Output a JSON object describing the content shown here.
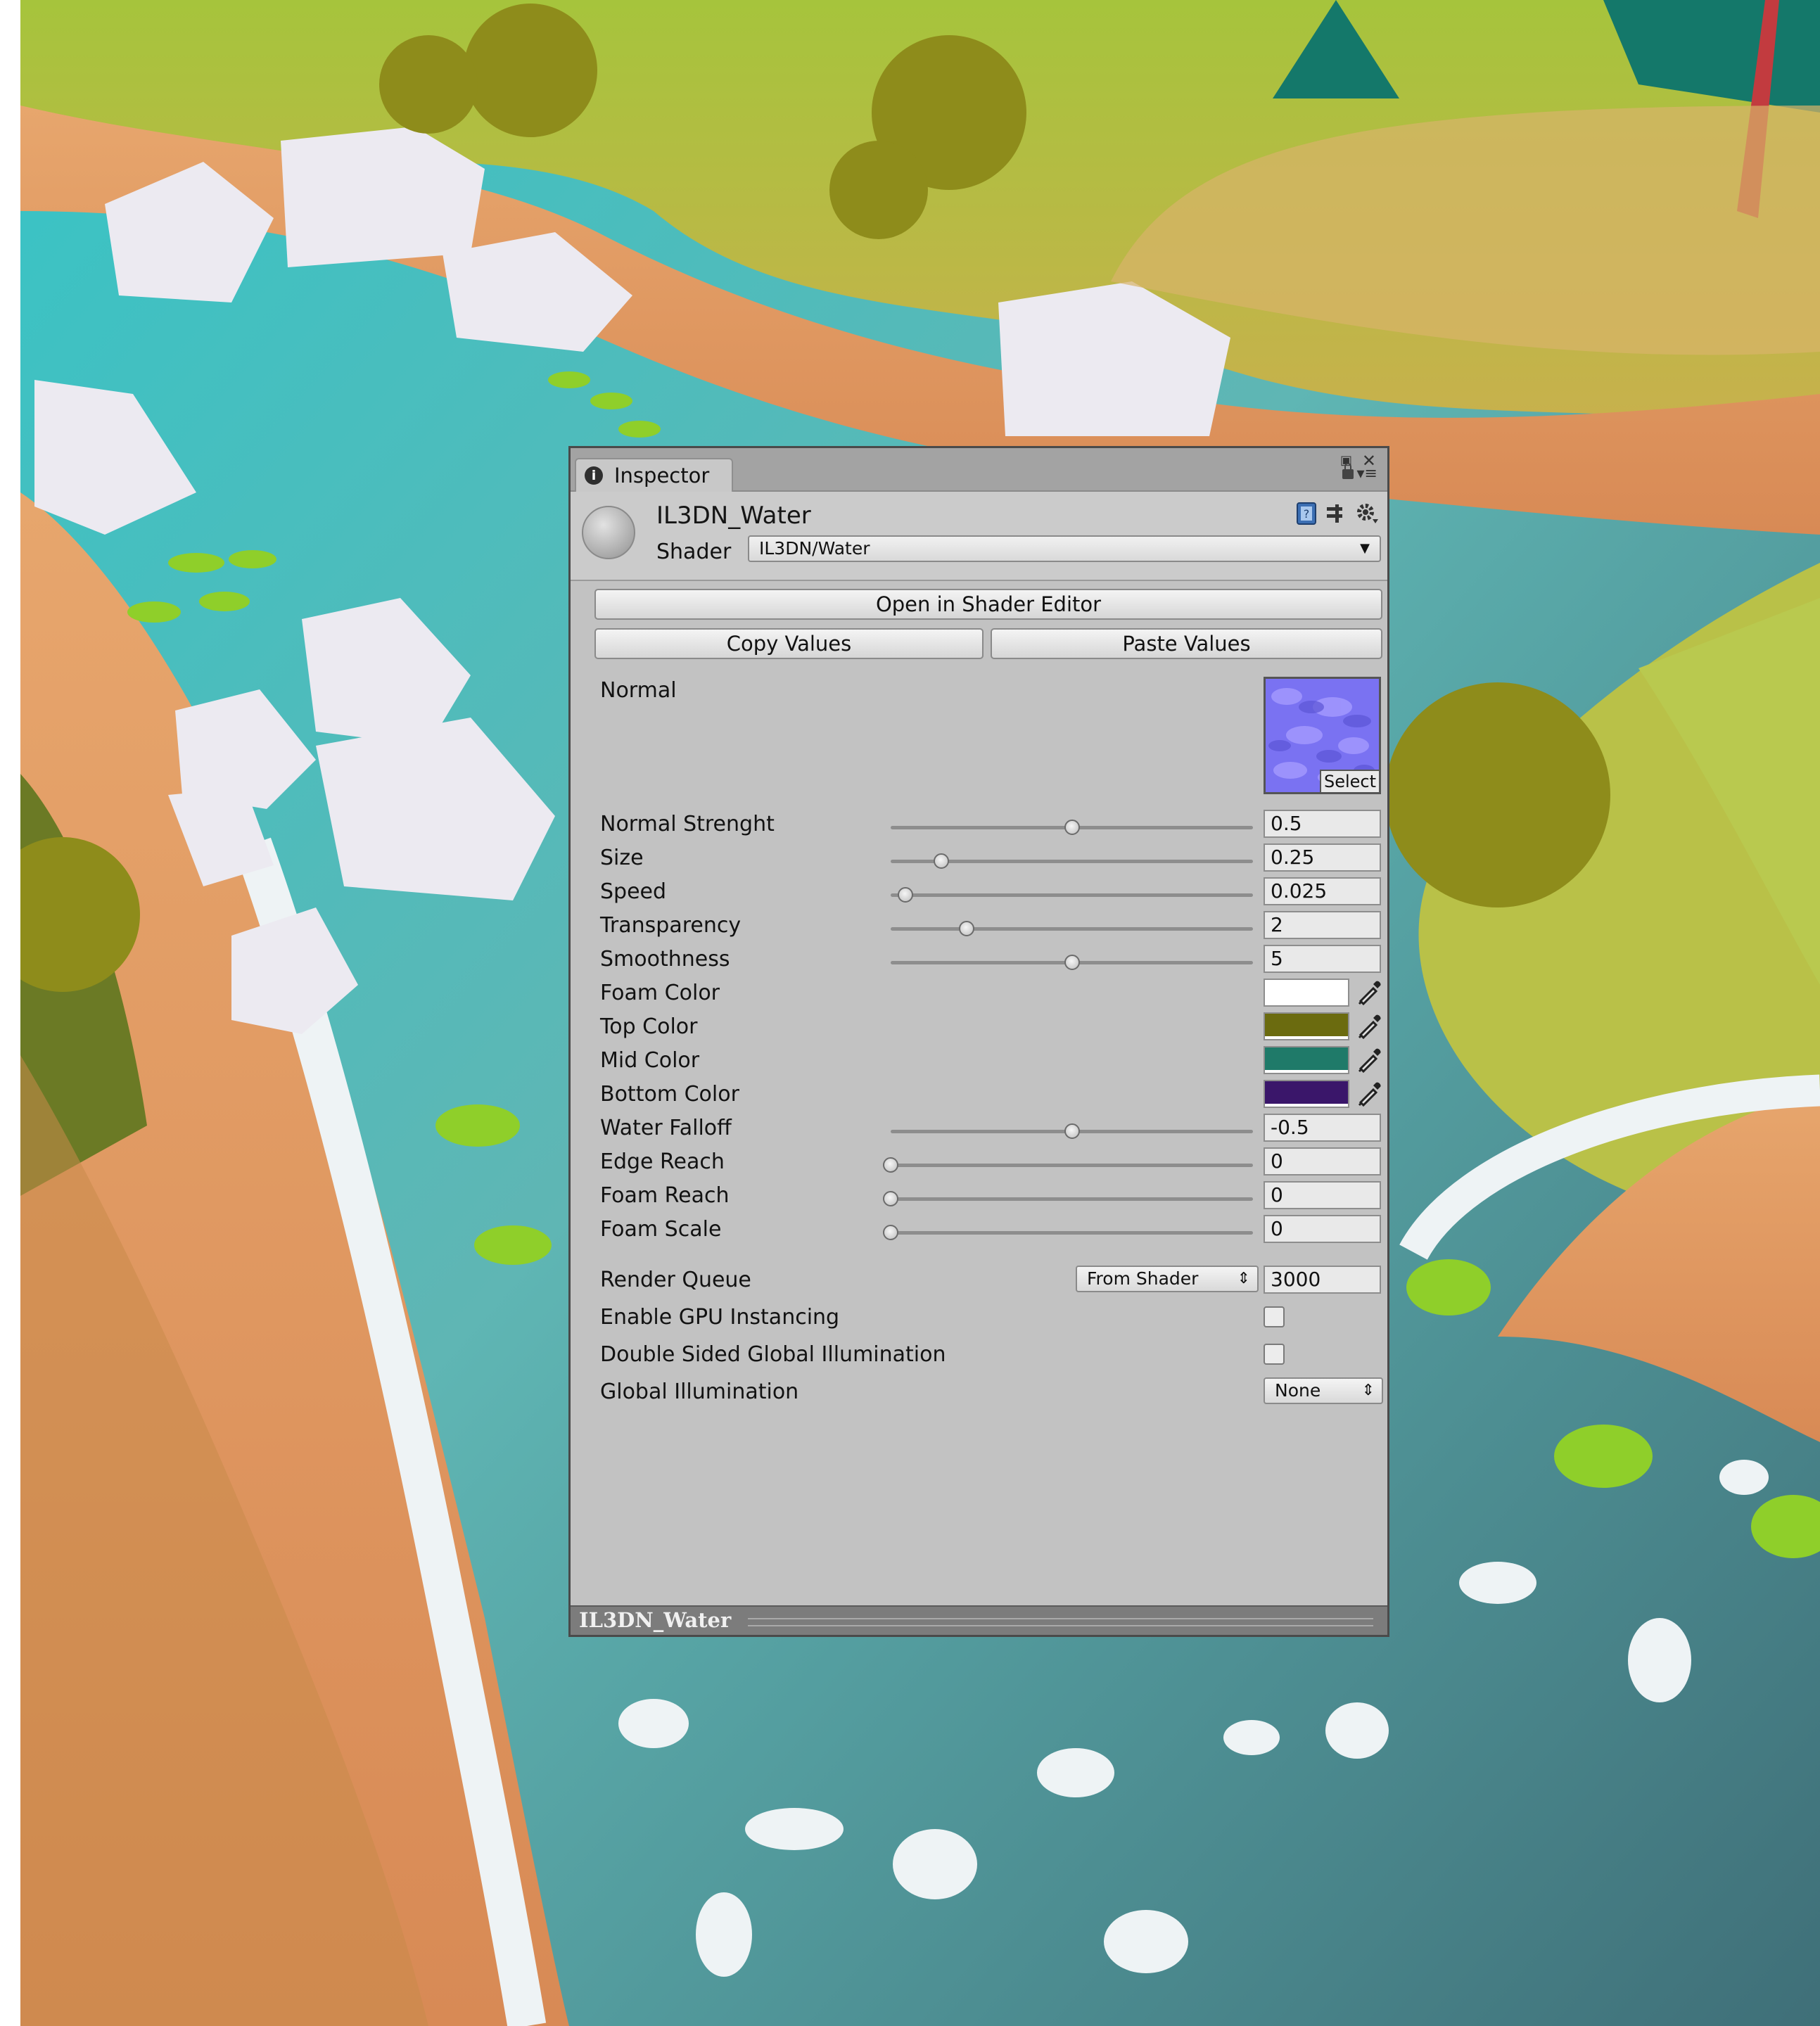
{
  "window": {
    "tab_label": "Inspector"
  },
  "material": {
    "name": "IL3DN_Water",
    "shader_label": "Shader",
    "shader_value": "IL3DN/Water"
  },
  "buttons": {
    "open_shader_editor": "Open in Shader Editor",
    "copy_values": "Copy Values",
    "paste_values": "Paste Values"
  },
  "texture": {
    "label": "Normal",
    "select_label": "Select"
  },
  "sliders": [
    {
      "label": "Normal Strenght",
      "value": "0.5",
      "fraction": 0.5
    },
    {
      "label": "Size",
      "value": "0.25",
      "fraction": 0.14
    },
    {
      "label": "Speed",
      "value": "0.025",
      "fraction": 0.04
    },
    {
      "label": "Transparency",
      "value": "2",
      "fraction": 0.21
    },
    {
      "label": "Smoothness",
      "value": "5",
      "fraction": 0.5
    }
  ],
  "colors": [
    {
      "label": "Foam Color",
      "hex": "#ffffff"
    },
    {
      "label": "Top Color",
      "hex": "#6b6b0f"
    },
    {
      "label": "Mid Color",
      "hex": "#1f7a69"
    },
    {
      "label": "Bottom Color",
      "hex": "#3a166a"
    }
  ],
  "sliders2": [
    {
      "label": "Water Falloff",
      "value": "-0.5",
      "fraction": 0.5
    },
    {
      "label": "Edge Reach",
      "value": "0",
      "fraction": 0.0
    },
    {
      "label": "Foam Reach",
      "value": "0",
      "fraction": 0.0
    },
    {
      "label": "Foam Scale",
      "value": "0",
      "fraction": 0.0
    }
  ],
  "render_queue": {
    "label": "Render Queue",
    "mode": "From Shader",
    "value": "3000"
  },
  "gpu_instancing": {
    "label": "Enable GPU Instancing",
    "checked": false
  },
  "double_sided_gi": {
    "label": "Double Sided Global Illumination",
    "checked": false
  },
  "global_illumination": {
    "label": "Global Illumination",
    "value": "None"
  },
  "footer": {
    "name": "IL3DN_Water"
  },
  "icons": [
    "info-icon",
    "maximize-icon",
    "close-icon",
    "lock-icon",
    "menu-icon",
    "help-book-icon",
    "preset-icon",
    "gear-icon",
    "eyedropper-icon"
  ],
  "accent_colors": {
    "panel": "#c2c2c2",
    "tab_bar": "#a3a3a3",
    "footer": "#7c7c7c"
  }
}
